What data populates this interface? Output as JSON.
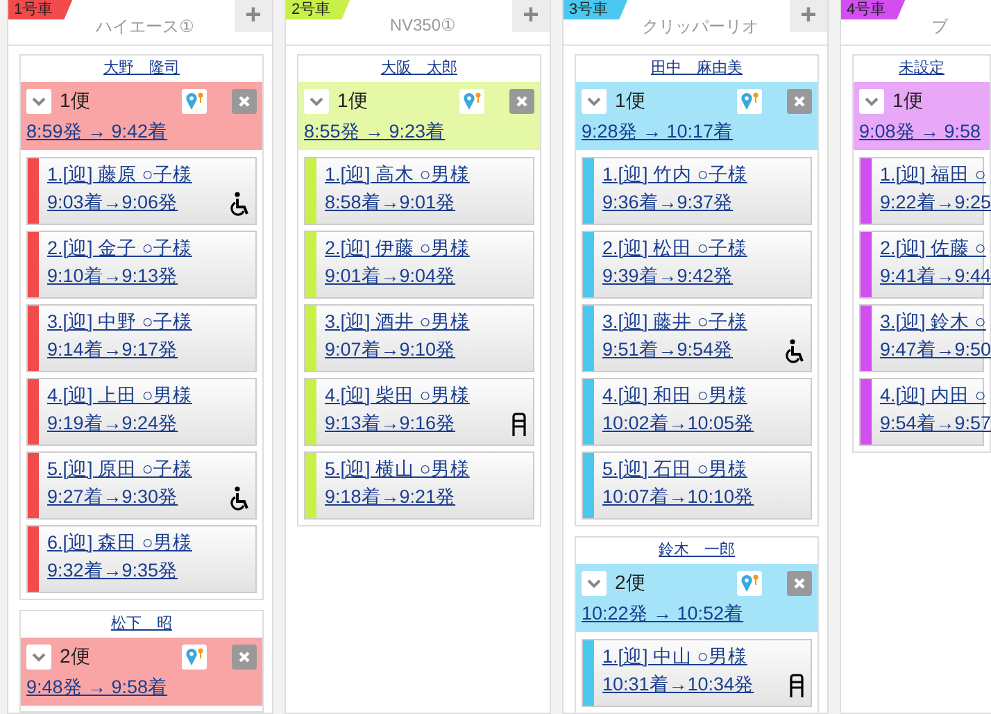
{
  "vehicles": [
    {
      "tag": "1号車",
      "color": "#f24b4b",
      "name": "ハイエース①",
      "add_button": "+",
      "trips": [
        {
          "driver": "大野　隆司",
          "trip_label": "1便",
          "times": "8:59発 → 9:42着",
          "map_button": true,
          "remove_button": true,
          "stops": [
            {
              "kind": "wheelchair",
              "label": "1.[迎] 藤原 ○子様",
              "times": "9:03着→9:06発"
            },
            {
              "kind": "plain",
              "label": "2.[迎] 金子 ○子様",
              "times": "9:10着→9:13発"
            },
            {
              "kind": "plain",
              "label": "3.[迎] 中野 ○子様",
              "times": "9:14着→9:17発"
            },
            {
              "kind": "plain",
              "label": "4.[迎] 上田 ○男様",
              "times": "9:19着→9:24発"
            },
            {
              "kind": "wheelchair",
              "label": "5.[迎] 原田 ○子様",
              "times": "9:27着→9:30発"
            },
            {
              "kind": "plain",
              "label": "6.[迎] 森田 ○男様",
              "times": "9:32着→9:35発"
            }
          ]
        },
        {
          "driver": "松下　昭",
          "trip_label": "2便",
          "times": "9:48発 → 9:58着",
          "map_button": true,
          "remove_button": true
        }
      ]
    },
    {
      "tag": "2号車",
      "color": "#c8f04a",
      "name": "NV350①",
      "add_button": "+",
      "trips": [
        {
          "driver": "大阪　太郎",
          "trip_label": "1便",
          "times": "8:55発 → 9:23着",
          "map_button": true,
          "remove_button": true,
          "stops": [
            {
              "kind": "plain",
              "label": "1.[迎] 高木 ○男様",
              "times": "8:58着→9:01発"
            },
            {
              "kind": "plain",
              "label": "2.[迎] 伊藤 ○男様",
              "times": "9:01着→9:04発"
            },
            {
              "kind": "plain",
              "label": "3.[迎] 酒井 ○男様",
              "times": "9:07着→9:10発"
            },
            {
              "kind": "walker",
              "label": "4.[迎] 柴田 ○男様",
              "times": "9:13着→9:16発"
            },
            {
              "kind": "plain",
              "label": "5.[迎] 横山 ○男様",
              "times": "9:18着→9:21発"
            }
          ]
        }
      ]
    },
    {
      "tag": "3号車",
      "color": "#4ac8f0",
      "name": "クリッパーリオ",
      "add_button": "+",
      "trips": [
        {
          "driver": "田中　麻由美",
          "trip_label": "1便",
          "times": "9:28発 → 10:17着",
          "map_button": true,
          "remove_button": true,
          "stops": [
            {
              "kind": "plain",
              "label": "1.[迎] 竹内 ○子様",
              "times": "9:36着→9:37発"
            },
            {
              "kind": "plain",
              "label": "2.[迎] 松田 ○子様",
              "times": "9:39着→9:42発"
            },
            {
              "kind": "wheelchair",
              "label": "3.[迎] 藤井 ○子様",
              "times": "9:51着→9:54発"
            },
            {
              "kind": "plain",
              "label": "4.[迎] 和田 ○男様",
              "times": "10:02着→10:05発"
            },
            {
              "kind": "plain",
              "label": "5.[迎] 石田 ○男様",
              "times": "10:07着→10:10発"
            }
          ]
        },
        {
          "driver": "鈴木　一郎",
          "trip_label": "2便",
          "times": "10:22発 → 10:52着",
          "map_button": true,
          "remove_button": true,
          "stops": [
            {
              "kind": "walker",
              "label": "1.[迎] 中山 ○男様",
              "times": "10:31着→10:34発"
            }
          ]
        }
      ]
    },
    {
      "tag": "4号車",
      "color": "#d24ef0",
      "name": "ブ",
      "trips": [
        {
          "driver": "未設定",
          "trip_label": "1便",
          "times": "9:08発 → 9:58",
          "stops": [
            {
              "kind": "plain",
              "label": "1.[迎] 福田 ○",
              "times": "9:22着→9:25"
            },
            {
              "kind": "plain",
              "label": "2.[迎] 佐藤 ○",
              "times": "9:41着→9:44"
            },
            {
              "kind": "plain",
              "label": "3.[迎] 鈴木 ○",
              "times": "9:47着→9:50"
            },
            {
              "kind": "plain",
              "label": "4.[迎] 内田 ○",
              "times": "9:54着→9:57"
            }
          ]
        }
      ]
    }
  ]
}
